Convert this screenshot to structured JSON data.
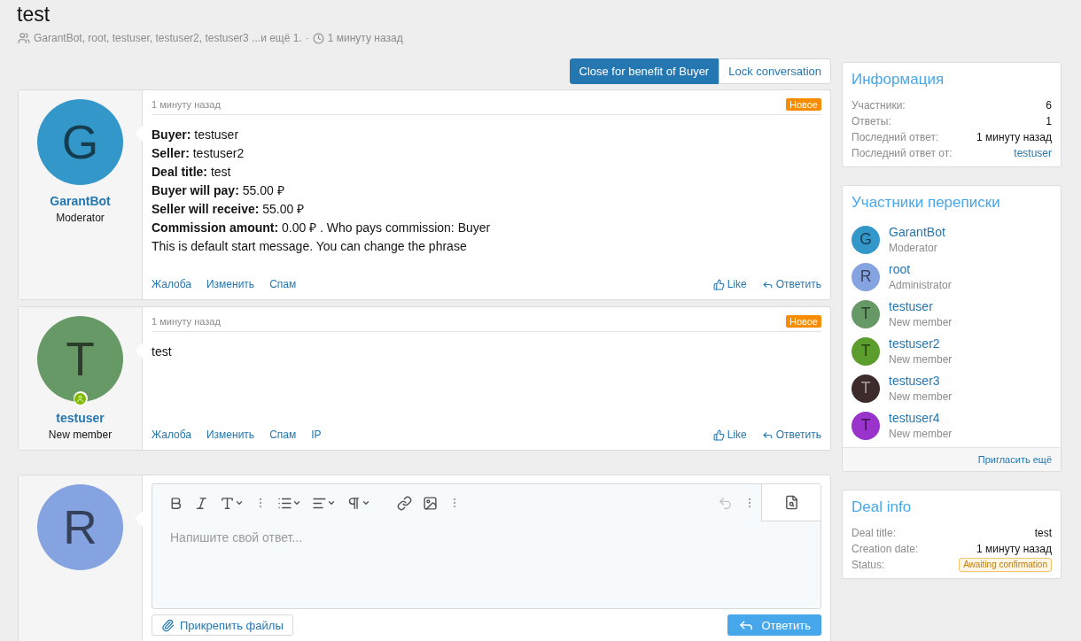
{
  "thread": {
    "title": "test",
    "participants": "GarantBot, root, testuser, testuser2, testuser3 ...и ещё 1.",
    "separator": "·",
    "time": "1 минуту назад"
  },
  "actions": [
    {
      "label": "Close for benefit of Buyer",
      "kind": "primary"
    },
    {
      "label": "Lock conversation",
      "kind": "plain"
    }
  ],
  "posts": [
    {
      "avatar": "G",
      "color": "#3398c9",
      "online": false,
      "author": "GarantBot",
      "role": "Moderator",
      "time": "1 минуту назад",
      "badge": "Новое",
      "lines": [
        "**Buyer:** testuser",
        "**Seller:** testuser2",
        "**Deal title:** test",
        "**Buyer will pay:** 55.00 ₽",
        "**Seller will receive:** 55.00 ₽",
        "**Commission amount:** 0.00 ₽ . Who pays commission: Buyer",
        "This is default start message. You can change the phrase"
      ],
      "links": [
        "Жалоба",
        "Изменить",
        "Спам"
      ],
      "like": "Like",
      "reply": "Ответить"
    },
    {
      "avatar": "T",
      "color": "#669966",
      "online": true,
      "author": "testuser",
      "role": "New member",
      "time": "1 минуту назад",
      "badge": "Новое",
      "lines": [
        "test"
      ],
      "links": [
        "Жалоба",
        "Изменить",
        "Спам",
        "IP"
      ],
      "like": "Like",
      "reply": "Ответить"
    }
  ],
  "reply_box": {
    "avatar": "R",
    "color": "#85a3e0",
    "placeholder": "Напишите свой ответ...",
    "undo_disabled": true,
    "attach": "Прикрепить файлы",
    "submit": "Ответить"
  },
  "info": {
    "title": "Информация",
    "rows": [
      {
        "label": "Участники:",
        "value": "6",
        "kind": "text"
      },
      {
        "label": "Ответы:",
        "value": "1",
        "kind": "text"
      },
      {
        "label": "Последний ответ:",
        "value": "1 минуту назад",
        "kind": "text"
      },
      {
        "label": "Последний ответ от:",
        "value": "testuser",
        "kind": "link"
      }
    ]
  },
  "participants": {
    "title": "Участники переписки",
    "members": [
      {
        "avatar": "G",
        "color": "#3398c9",
        "name": "GarantBot",
        "role": "Moderator"
      },
      {
        "avatar": "R",
        "color": "#85a3e0",
        "name": "root",
        "role": "Administrator"
      },
      {
        "avatar": "T",
        "color": "#669966",
        "name": "testuser",
        "role": "New member"
      },
      {
        "avatar": "T",
        "color": "#5c9e2e",
        "name": "testuser2",
        "role": "New member"
      },
      {
        "avatar": "T",
        "color": "#3d2b2b",
        "name": "testuser3",
        "role": "New member"
      },
      {
        "avatar": "T",
        "color": "#9933cc",
        "name": "testuser4",
        "role": "New member"
      }
    ],
    "invite": "Пригласить ещё"
  },
  "deal": {
    "title": "Deal info",
    "rows": [
      {
        "label": "Deal title:",
        "value": "test",
        "kind": "text"
      },
      {
        "label": "Creation date:",
        "value": "1 минуту назад",
        "kind": "text"
      },
      {
        "label": "Status:",
        "value": "Awaiting confirmation",
        "kind": "badge"
      }
    ]
  }
}
